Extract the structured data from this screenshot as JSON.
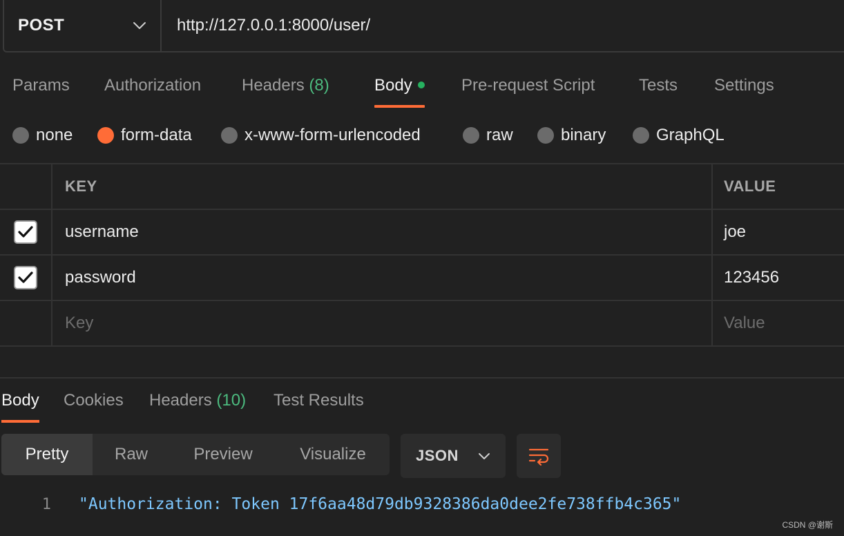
{
  "request": {
    "method": "POST",
    "url": "http://127.0.0.1:8000/user/"
  },
  "request_tabs": [
    {
      "label": "Params"
    },
    {
      "label": "Authorization"
    },
    {
      "label": "Headers",
      "count": "(8)"
    },
    {
      "label": "Body",
      "active": true
    },
    {
      "label": "Pre-request Script"
    },
    {
      "label": "Tests"
    },
    {
      "label": "Settings"
    }
  ],
  "body_types": [
    {
      "label": "none"
    },
    {
      "label": "form-data",
      "selected": true
    },
    {
      "label": "x-www-form-urlencoded"
    },
    {
      "label": "raw"
    },
    {
      "label": "binary"
    },
    {
      "label": "GraphQL"
    }
  ],
  "form_table": {
    "headers": {
      "key": "KEY",
      "value": "VALUE"
    },
    "rows": [
      {
        "checked": true,
        "key": "username",
        "value": "joe"
      },
      {
        "checked": true,
        "key": "password",
        "value": "123456"
      }
    ],
    "new_row": {
      "key_placeholder": "Key",
      "value_placeholder": "Value"
    }
  },
  "response_tabs": [
    {
      "label": "Body",
      "active": true
    },
    {
      "label": "Cookies"
    },
    {
      "label": "Headers",
      "count": "(10)"
    },
    {
      "label": "Test Results"
    }
  ],
  "view_modes": [
    {
      "label": "Pretty",
      "active": true
    },
    {
      "label": "Raw"
    },
    {
      "label": "Preview"
    },
    {
      "label": "Visualize"
    }
  ],
  "format": "JSON",
  "response_body": {
    "line_number": "1",
    "text": "\"Authorization: Token 17f6aa48d79db9328386da0dee2fe738ffb4c365\""
  },
  "watermark": "CSDN @谢斯",
  "colors": {
    "accent": "#ff6c37",
    "count_green": "#4cbb7f",
    "dot_green": "#26b15f",
    "code_blue": "#7ec8ff"
  },
  "icons": {
    "method_dropdown": "chevron-down-icon",
    "format_dropdown": "chevron-down-icon",
    "wrap": "wrap-lines-icon",
    "check": "check-icon"
  }
}
